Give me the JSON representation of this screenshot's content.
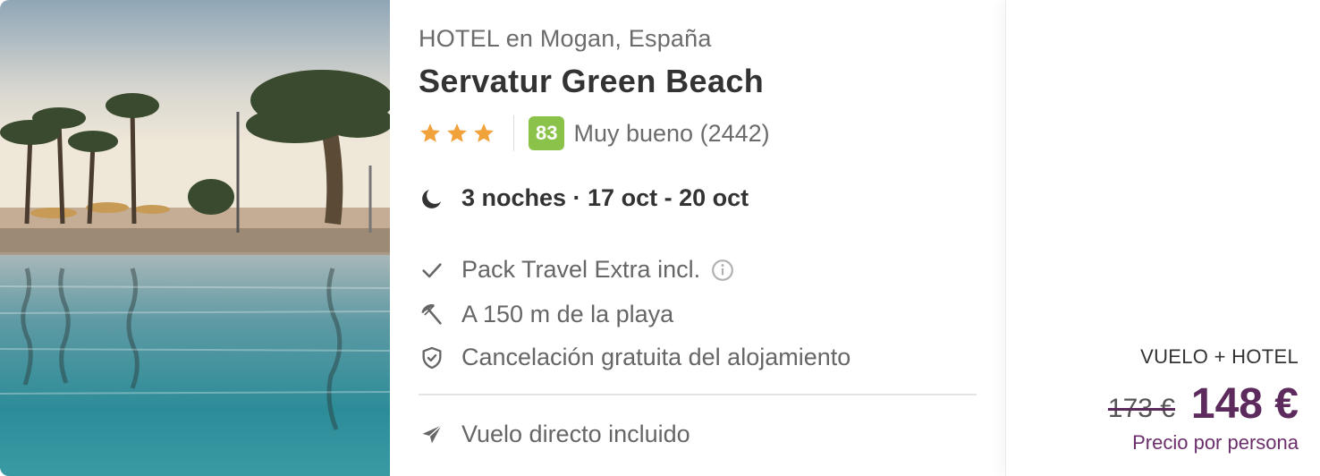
{
  "hotel": {
    "location": "HOTEL en Mogan, España",
    "name": "Servatur Green Beach",
    "stars": 3,
    "score": "83",
    "score_text": "Muy bueno (2442)",
    "score_color": "#8bc34a",
    "nights": "3 noches · 17 oct - 20 oct"
  },
  "features": [
    {
      "icon": "check-icon",
      "label": "Pack Travel Extra incl."
    },
    {
      "icon": "beach-umbrella-icon",
      "label": "A 150 m de la playa"
    },
    {
      "icon": "shield-check-icon",
      "label": "Cancelación gratuita del alojamiento"
    }
  ],
  "flight": {
    "icon": "plane-icon",
    "label": "Vuelo directo incluido"
  },
  "price": {
    "package": "VUELO + HOTEL",
    "old": "173 €",
    "new": "148 €",
    "per": "Precio por persona",
    "accent": "#5d2a5d"
  },
  "photo": {
    "icon": "hotel-pool-photo"
  }
}
